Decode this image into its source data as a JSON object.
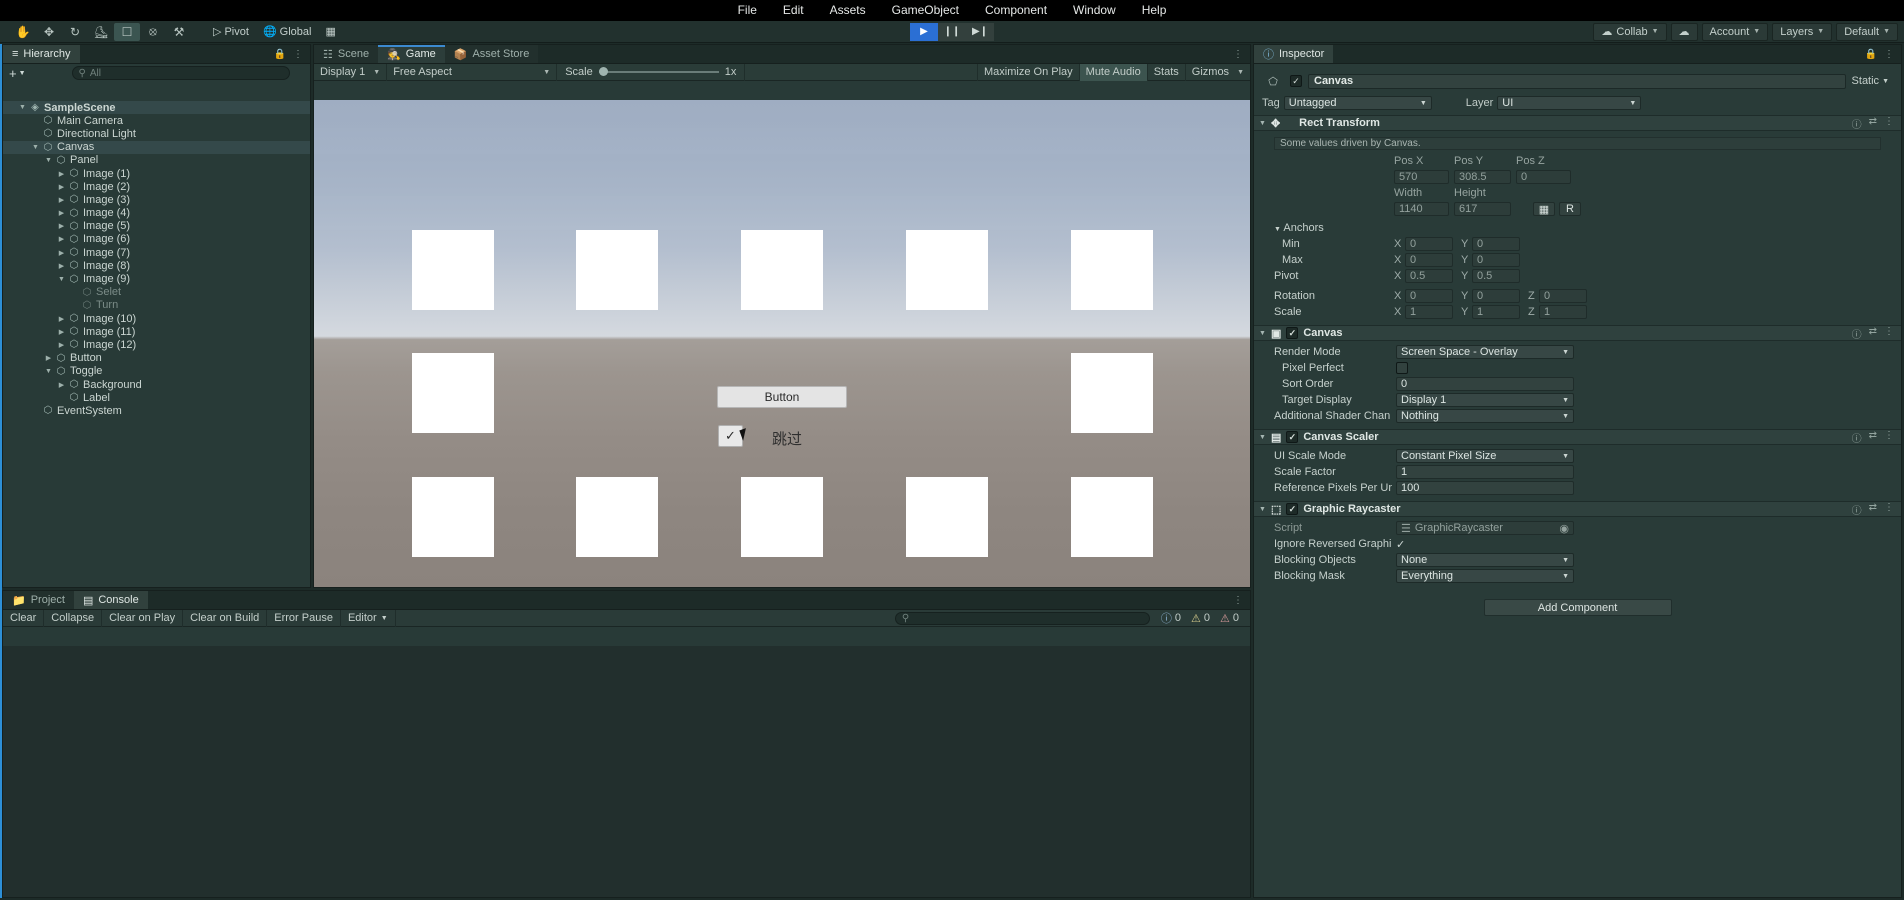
{
  "menubar": [
    "File",
    "Edit",
    "Assets",
    "GameObject",
    "Component",
    "Window",
    "Help"
  ],
  "toolbar": {
    "tools": [
      "hand-tool",
      "move-tool",
      "rotate-tool",
      "scale-tool",
      "rect-tool",
      "transform-tool",
      "custom-tool"
    ],
    "pivot_label": "Pivot",
    "global_label": "Global",
    "play": "▶",
    "pause": "❙❙",
    "step": "▶❙",
    "collab": "Collab",
    "account": "Account",
    "layers": "Layers",
    "layout": "Default"
  },
  "hierarchy": {
    "tab": "Hierarchy",
    "add_label": "+",
    "search_placeholder": "All",
    "items": [
      {
        "label": "SampleScene",
        "depth": 0,
        "arrow": "down",
        "icon": "scene-icon",
        "selected": true,
        "dim": false
      },
      {
        "label": "Main Camera",
        "depth": 1,
        "arrow": "none",
        "icon": "gameobject-icon",
        "selected": false,
        "dim": false
      },
      {
        "label": "Directional Light",
        "depth": 1,
        "arrow": "none",
        "icon": "gameobject-icon",
        "selected": false,
        "dim": false
      },
      {
        "label": "Canvas",
        "depth": 1,
        "arrow": "down",
        "icon": "gameobject-icon",
        "selected": true,
        "dim": false
      },
      {
        "label": "Panel",
        "depth": 2,
        "arrow": "down",
        "icon": "gameobject-icon",
        "selected": false,
        "dim": false
      },
      {
        "label": "Image (1)",
        "depth": 3,
        "arrow": "right",
        "icon": "gameobject-icon",
        "selected": false,
        "dim": false
      },
      {
        "label": "Image (2)",
        "depth": 3,
        "arrow": "right",
        "icon": "gameobject-icon",
        "selected": false,
        "dim": false
      },
      {
        "label": "Image (3)",
        "depth": 3,
        "arrow": "right",
        "icon": "gameobject-icon",
        "selected": false,
        "dim": false
      },
      {
        "label": "Image (4)",
        "depth": 3,
        "arrow": "right",
        "icon": "gameobject-icon",
        "selected": false,
        "dim": false
      },
      {
        "label": "Image (5)",
        "depth": 3,
        "arrow": "right",
        "icon": "gameobject-icon",
        "selected": false,
        "dim": false
      },
      {
        "label": "Image (6)",
        "depth": 3,
        "arrow": "right",
        "icon": "gameobject-icon",
        "selected": false,
        "dim": false
      },
      {
        "label": "Image (7)",
        "depth": 3,
        "arrow": "right",
        "icon": "gameobject-icon",
        "selected": false,
        "dim": false
      },
      {
        "label": "Image (8)",
        "depth": 3,
        "arrow": "right",
        "icon": "gameobject-icon",
        "selected": false,
        "dim": false
      },
      {
        "label": "Image (9)",
        "depth": 3,
        "arrow": "down",
        "icon": "gameobject-icon",
        "selected": false,
        "dim": false
      },
      {
        "label": "Selet",
        "depth": 4,
        "arrow": "none",
        "icon": "gameobject-icon",
        "selected": false,
        "dim": true
      },
      {
        "label": "Turn",
        "depth": 4,
        "arrow": "none",
        "icon": "gameobject-icon",
        "selected": false,
        "dim": true
      },
      {
        "label": "Image (10)",
        "depth": 3,
        "arrow": "right",
        "icon": "gameobject-icon",
        "selected": false,
        "dim": false
      },
      {
        "label": "Image (11)",
        "depth": 3,
        "arrow": "right",
        "icon": "gameobject-icon",
        "selected": false,
        "dim": false
      },
      {
        "label": "Image (12)",
        "depth": 3,
        "arrow": "right",
        "icon": "gameobject-icon",
        "selected": false,
        "dim": false
      },
      {
        "label": "Button",
        "depth": 2,
        "arrow": "right",
        "icon": "gameobject-icon",
        "selected": false,
        "dim": false
      },
      {
        "label": "Toggle",
        "depth": 2,
        "arrow": "down",
        "icon": "gameobject-icon",
        "selected": false,
        "dim": false
      },
      {
        "label": "Background",
        "depth": 3,
        "arrow": "right",
        "icon": "gameobject-icon",
        "selected": false,
        "dim": false
      },
      {
        "label": "Label",
        "depth": 3,
        "arrow": "none",
        "icon": "gameobject-icon",
        "selected": false,
        "dim": false
      },
      {
        "label": "EventSystem",
        "depth": 1,
        "arrow": "none",
        "icon": "gameobject-icon",
        "selected": false,
        "dim": false
      }
    ]
  },
  "gameview": {
    "tabs": [
      {
        "label": "Scene",
        "icon": "scene-grid-icon",
        "active": false
      },
      {
        "label": "Game",
        "icon": "gamepad-icon",
        "active": true
      },
      {
        "label": "Asset Store",
        "icon": "store-icon",
        "active": false
      }
    ],
    "display": "Display 1",
    "aspect": "Free Aspect",
    "scale_label": "Scale",
    "scale_value": "1x",
    "maximize": "Maximize On Play",
    "mute": "Mute Audio",
    "stats": "Stats",
    "gizmos": "Gizmos",
    "ui": {
      "button_label": "Button",
      "toggle_check": "✓",
      "toggle_label": "跳过"
    }
  },
  "inspector": {
    "tab": "Inspector",
    "object_name": "Canvas",
    "enabled": true,
    "static_label": "Static",
    "tag_label": "Tag",
    "tag_value": "Untagged",
    "layer_label": "Layer",
    "layer_value": "UI",
    "components": [
      {
        "name": "Rect Transform",
        "icon": "rect-transform-icon",
        "note": "Some values driven by Canvas.",
        "headers": [
          "Pos X",
          "Pos Y",
          "Pos Z"
        ],
        "pos": [
          "570",
          "308.5",
          "0"
        ],
        "size_headers": [
          "Width",
          "Height"
        ],
        "size": [
          "1140",
          "617"
        ],
        "anchors_label": "Anchors",
        "min_label": "Min",
        "min": [
          "0",
          "0"
        ],
        "max_label": "Max",
        "max": [
          "0",
          "0"
        ],
        "pivot_label": "Pivot",
        "pivot": [
          "0.5",
          "0.5"
        ],
        "rotation_label": "Rotation",
        "rotation": [
          "0",
          "0",
          "0"
        ],
        "scale_label": "Scale",
        "scale": [
          "1",
          "1",
          "1"
        ]
      },
      {
        "name": "Canvas",
        "icon": "canvas-icon",
        "enabled": true,
        "rows": [
          {
            "label": "Render Mode",
            "value": "Screen Space - Overlay",
            "type": "dropdown",
            "indent": 0
          },
          {
            "label": "Pixel Perfect",
            "value": "",
            "type": "checkbox",
            "indent": 1
          },
          {
            "label": "Sort Order",
            "value": "0",
            "type": "text",
            "indent": 1
          },
          {
            "label": "Target Display",
            "value": "Display 1",
            "type": "dropdown",
            "indent": 1
          },
          {
            "label": "Additional Shader Chan",
            "value": "Nothing",
            "type": "dropdown",
            "indent": 0
          }
        ]
      },
      {
        "name": "Canvas Scaler",
        "icon": "canvas-scaler-icon",
        "enabled": true,
        "rows": [
          {
            "label": "UI Scale Mode",
            "value": "Constant Pixel Size",
            "type": "dropdown",
            "indent": 0
          },
          {
            "label": "Scale Factor",
            "value": "1",
            "type": "text",
            "indent": 0
          },
          {
            "label": "Reference Pixels Per Ur",
            "value": "100",
            "type": "text",
            "indent": 0
          }
        ]
      },
      {
        "name": "Graphic Raycaster",
        "icon": "graphic-raycaster-icon",
        "enabled": true,
        "rows": [
          {
            "label": "Script",
            "value": "GraphicRaycaster",
            "type": "script",
            "indent": 0
          },
          {
            "label": "Ignore Reversed Graphi",
            "value": "✓",
            "type": "checkbox-on",
            "indent": 0
          },
          {
            "label": "Blocking Objects",
            "value": "None",
            "type": "dropdown",
            "indent": 0
          },
          {
            "label": "Blocking Mask",
            "value": "Everything",
            "type": "dropdown",
            "indent": 0
          }
        ]
      }
    ],
    "add_component": "Add Component"
  },
  "console": {
    "tabs": [
      {
        "label": "Project",
        "icon": "folder-icon",
        "active": false
      },
      {
        "label": "Console",
        "icon": "console-icon",
        "active": true
      }
    ],
    "buttons": [
      "Clear",
      "Collapse",
      "Clear on Play",
      "Clear on Build",
      "Error Pause"
    ],
    "editor_label": "Editor",
    "counts": {
      "info": "0",
      "warning": "0",
      "error": "0"
    }
  }
}
